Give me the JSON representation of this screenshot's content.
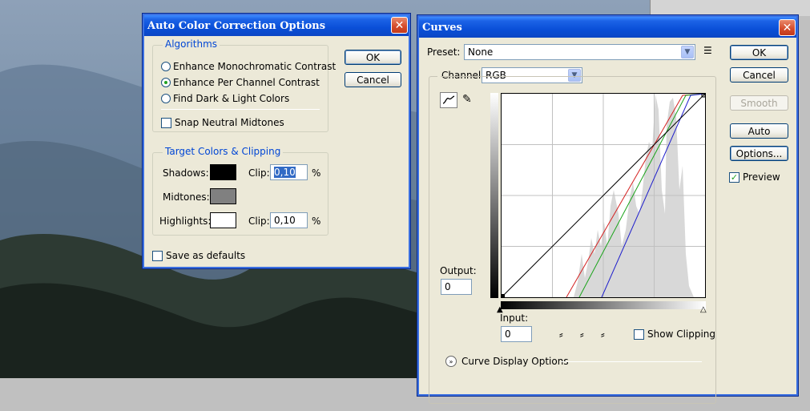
{
  "auto_color": {
    "title": "Auto Color Correction Options",
    "ok_label": "OK",
    "cancel_label": "Cancel",
    "algorithms": {
      "legend": "Algorithms",
      "options": [
        "Enhance Monochromatic Contrast",
        "Enhance Per Channel Contrast",
        "Find Dark & Light Colors"
      ],
      "selected_index": 1,
      "snap_label": "Snap Neutral Midtones",
      "snap_checked": false
    },
    "target": {
      "legend": "Target Colors & Clipping",
      "shadows_label": "Shadows:",
      "midtones_label": "Midtones:",
      "highlights_label": "Highlights:",
      "clip_label": "Clip:",
      "shadows_clip": "0,10",
      "highlights_clip": "0,10",
      "percent": "%",
      "shadows_color": "#000000",
      "midtones_color": "#808080",
      "highlights_color": "#ffffff"
    },
    "save_defaults_label": "Save as defaults",
    "save_defaults_checked": false
  },
  "curves": {
    "title": "Curves",
    "preset_label": "Preset:",
    "preset_value": "None",
    "channel_label": "Channel:",
    "channel_value": "RGB",
    "ok_label": "OK",
    "cancel_label": "Cancel",
    "smooth_label": "Smooth",
    "auto_label": "Auto",
    "options_label": "Options...",
    "preview_label": "Preview",
    "preview_checked": true,
    "output_label": "Output:",
    "output_value": "0",
    "input_label": "Input:",
    "input_value": "0",
    "show_clipping_label": "Show Clipping",
    "show_clipping_checked": false,
    "curve_display_options_label": "Curve Display Options",
    "colors": {
      "red": "#d42020",
      "green": "#19a319",
      "blue": "#1d1dcc",
      "rgb": "#000000"
    }
  }
}
